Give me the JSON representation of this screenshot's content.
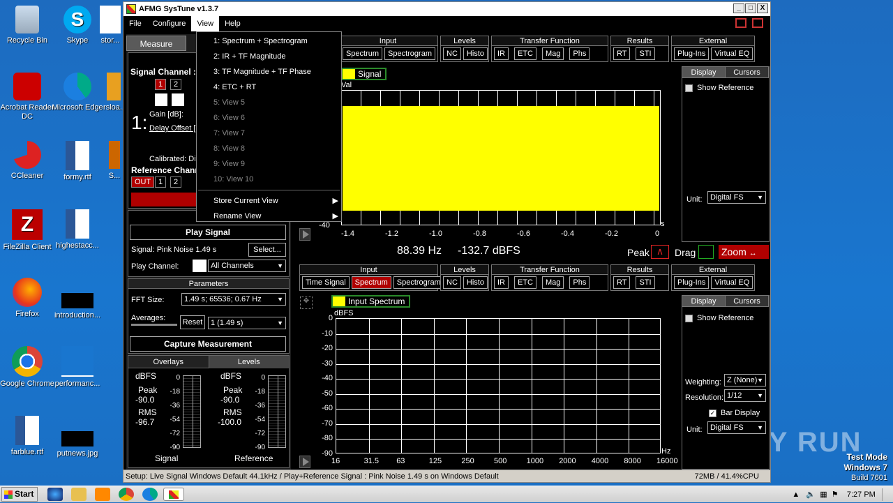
{
  "desktop": {
    "icons": [
      {
        "label": "Recycle Bin"
      },
      {
        "label": "Skype"
      },
      {
        "label": "stor..."
      },
      {
        "label": "Acrobat Reader DC"
      },
      {
        "label": "Microsoft Edge"
      },
      {
        "label": "rsloa..."
      },
      {
        "label": "CCleaner"
      },
      {
        "label": "formy.rtf"
      },
      {
        "label": "S..."
      },
      {
        "label": "FileZilla Client"
      },
      {
        "label": "highestacc..."
      },
      {
        "label": "Firefox"
      },
      {
        "label": "introduction..."
      },
      {
        "label": "Google Chrome"
      },
      {
        "label": "performanc..."
      },
      {
        "label": "farblue.rtf"
      },
      {
        "label": "putnews.jpg"
      }
    ],
    "watermark": {
      "line1": "Test Mode",
      "line2": "Windows 7",
      "line3": "Build 7601"
    },
    "anyrun": "ANY RUN"
  },
  "window": {
    "title": "AFMG SysTune v1.3.7",
    "controls": [
      "_",
      "□",
      "X"
    ],
    "menu": [
      "File",
      "Configure",
      "View",
      "Help"
    ]
  },
  "view_menu": {
    "items": [
      {
        "label": "1: Spectrum + Spectrogram",
        "enabled": true
      },
      {
        "label": "2: IR + TF Magnitude",
        "enabled": true
      },
      {
        "label": "3: TF Magnitude + TF Phase",
        "enabled": true
      },
      {
        "label": "4: ETC + RT",
        "enabled": true
      },
      {
        "label": "5: View 5",
        "enabled": false
      },
      {
        "label": "6: View 6",
        "enabled": false
      },
      {
        "label": "7: View 7",
        "enabled": false
      },
      {
        "label": "8: View 8",
        "enabled": false
      },
      {
        "label": "9: View 9",
        "enabled": false
      },
      {
        "label": "10: View 10",
        "enabled": false
      }
    ],
    "store": "Store Current View",
    "rename": "Rename View"
  },
  "left": {
    "tab": "Measure",
    "signal_channel": "Signal Channel :",
    "ch1": "1",
    "ch2": "2",
    "big_label": "1:",
    "gain": "Gain [dB]:",
    "delay": "Delay Offset [",
    "calibrated": "Calibrated: Dig",
    "ref_channel": "Reference Chann",
    "out": "OUT",
    "stop": "Sto",
    "play_signal": "Play Signal",
    "signal_info": "Signal: Pink Noise  1.49 s",
    "select": "Select...",
    "play_channel": "Play Channel:",
    "all_channels": "All Channels",
    "parameters": "Parameters",
    "fft_size_label": "FFT Size:",
    "fft_size": "1.49 s; 65536; 0.67 Hz",
    "averages": "Averages:",
    "reset": "Reset",
    "avg_value": "1 (1.49 s)",
    "capture": "Capture Measurement",
    "tab_overlays": "Overlays",
    "tab_levels": "Levels",
    "meter_signal": {
      "unit": "dBFS",
      "peak_label": "Peak",
      "peak": "-90.0",
      "rms_label": "RMS",
      "rms": "-96.7",
      "name": "Signal"
    },
    "meter_ref": {
      "unit": "dBFS",
      "peak_label": "Peak",
      "peak": "-90.0",
      "rms_label": "RMS",
      "rms": "-100.0",
      "name": "Reference"
    },
    "meter_scale": [
      "0",
      "-18",
      "-36",
      "-54",
      "-72",
      "-90"
    ]
  },
  "top_toolbar": {
    "input_head": "Input",
    "input": [
      "Spectrum",
      "Spectrogram"
    ],
    "levels_head": "Levels",
    "levels": [
      "NC",
      "Histo"
    ],
    "tf_head": "Transfer Function",
    "tf": [
      "IR",
      "ETC",
      "Mag",
      "Phs"
    ],
    "results_head": "Results",
    "results": [
      "RT",
      "STI"
    ],
    "external_head": "External",
    "external": [
      "Plug-Ins",
      "Virtual EQ"
    ]
  },
  "bottom_toolbar": {
    "input_head": "Input",
    "input": [
      "Time Signal",
      "Spectrum",
      "Spectrogram"
    ],
    "levels_head": "Levels",
    "levels": [
      "NC",
      "Histo"
    ],
    "tf_head": "Transfer Function",
    "tf": [
      "IR",
      "ETC",
      "Mag",
      "Phs"
    ],
    "results_head": "Results",
    "results": [
      "RT",
      "STI"
    ],
    "external_head": "External",
    "external": [
      "Plug-Ins",
      "Virtual EQ"
    ]
  },
  "top_plot": {
    "legend": "Signal",
    "yaxis_label": "Val",
    "ymin_label": "-40",
    "xticks": [
      "-1.4",
      "-1.2",
      "-1.0",
      "-0.8",
      "-0.6",
      "-0.4",
      "-0.2",
      "0"
    ],
    "xunit": "s",
    "side_display": "Display",
    "side_cursors": "Cursors",
    "show_reference": "Show Reference",
    "unit_label": "Unit:",
    "unit_value": "Digital FS"
  },
  "readout": {
    "freq": "88.39 Hz",
    "level": "-132.7 dBFS",
    "peak": "Peak",
    "drag": "Drag",
    "zoom": "Zoom"
  },
  "bottom_plot": {
    "legend": "Input Spectrum",
    "yunit": "dBFS",
    "yticks": [
      "0",
      "-10",
      "-20",
      "-30",
      "-40",
      "-50",
      "-60",
      "-70",
      "-80",
      "-90"
    ],
    "xticks": [
      "16",
      "31.5",
      "63",
      "125",
      "250",
      "500",
      "1000",
      "2000",
      "4000",
      "8000",
      "16000"
    ],
    "xunit": "Hz",
    "side_display": "Display",
    "side_cursors": "Cursors",
    "show_reference": "Show Reference",
    "weighting_label": "Weighting:",
    "weighting": "Z (None)",
    "resolution_label": "Resolution:",
    "resolution": "1/12",
    "bar_display": "Bar Display",
    "unit_label": "Unit:",
    "unit_value": "Digital FS"
  },
  "status": {
    "left": "Setup: Live Signal Windows Default 44.1kHz / Play+Reference Signal : Pink Noise  1.49 s on Windows Default",
    "right": "72MB / 41.4%CPU"
  },
  "taskbar": {
    "start": "Start",
    "time": "7:27 PM"
  },
  "colors": {
    "signal": "#ffff00",
    "active_red": "#b00000",
    "legend_border": "#2a8a2a"
  }
}
